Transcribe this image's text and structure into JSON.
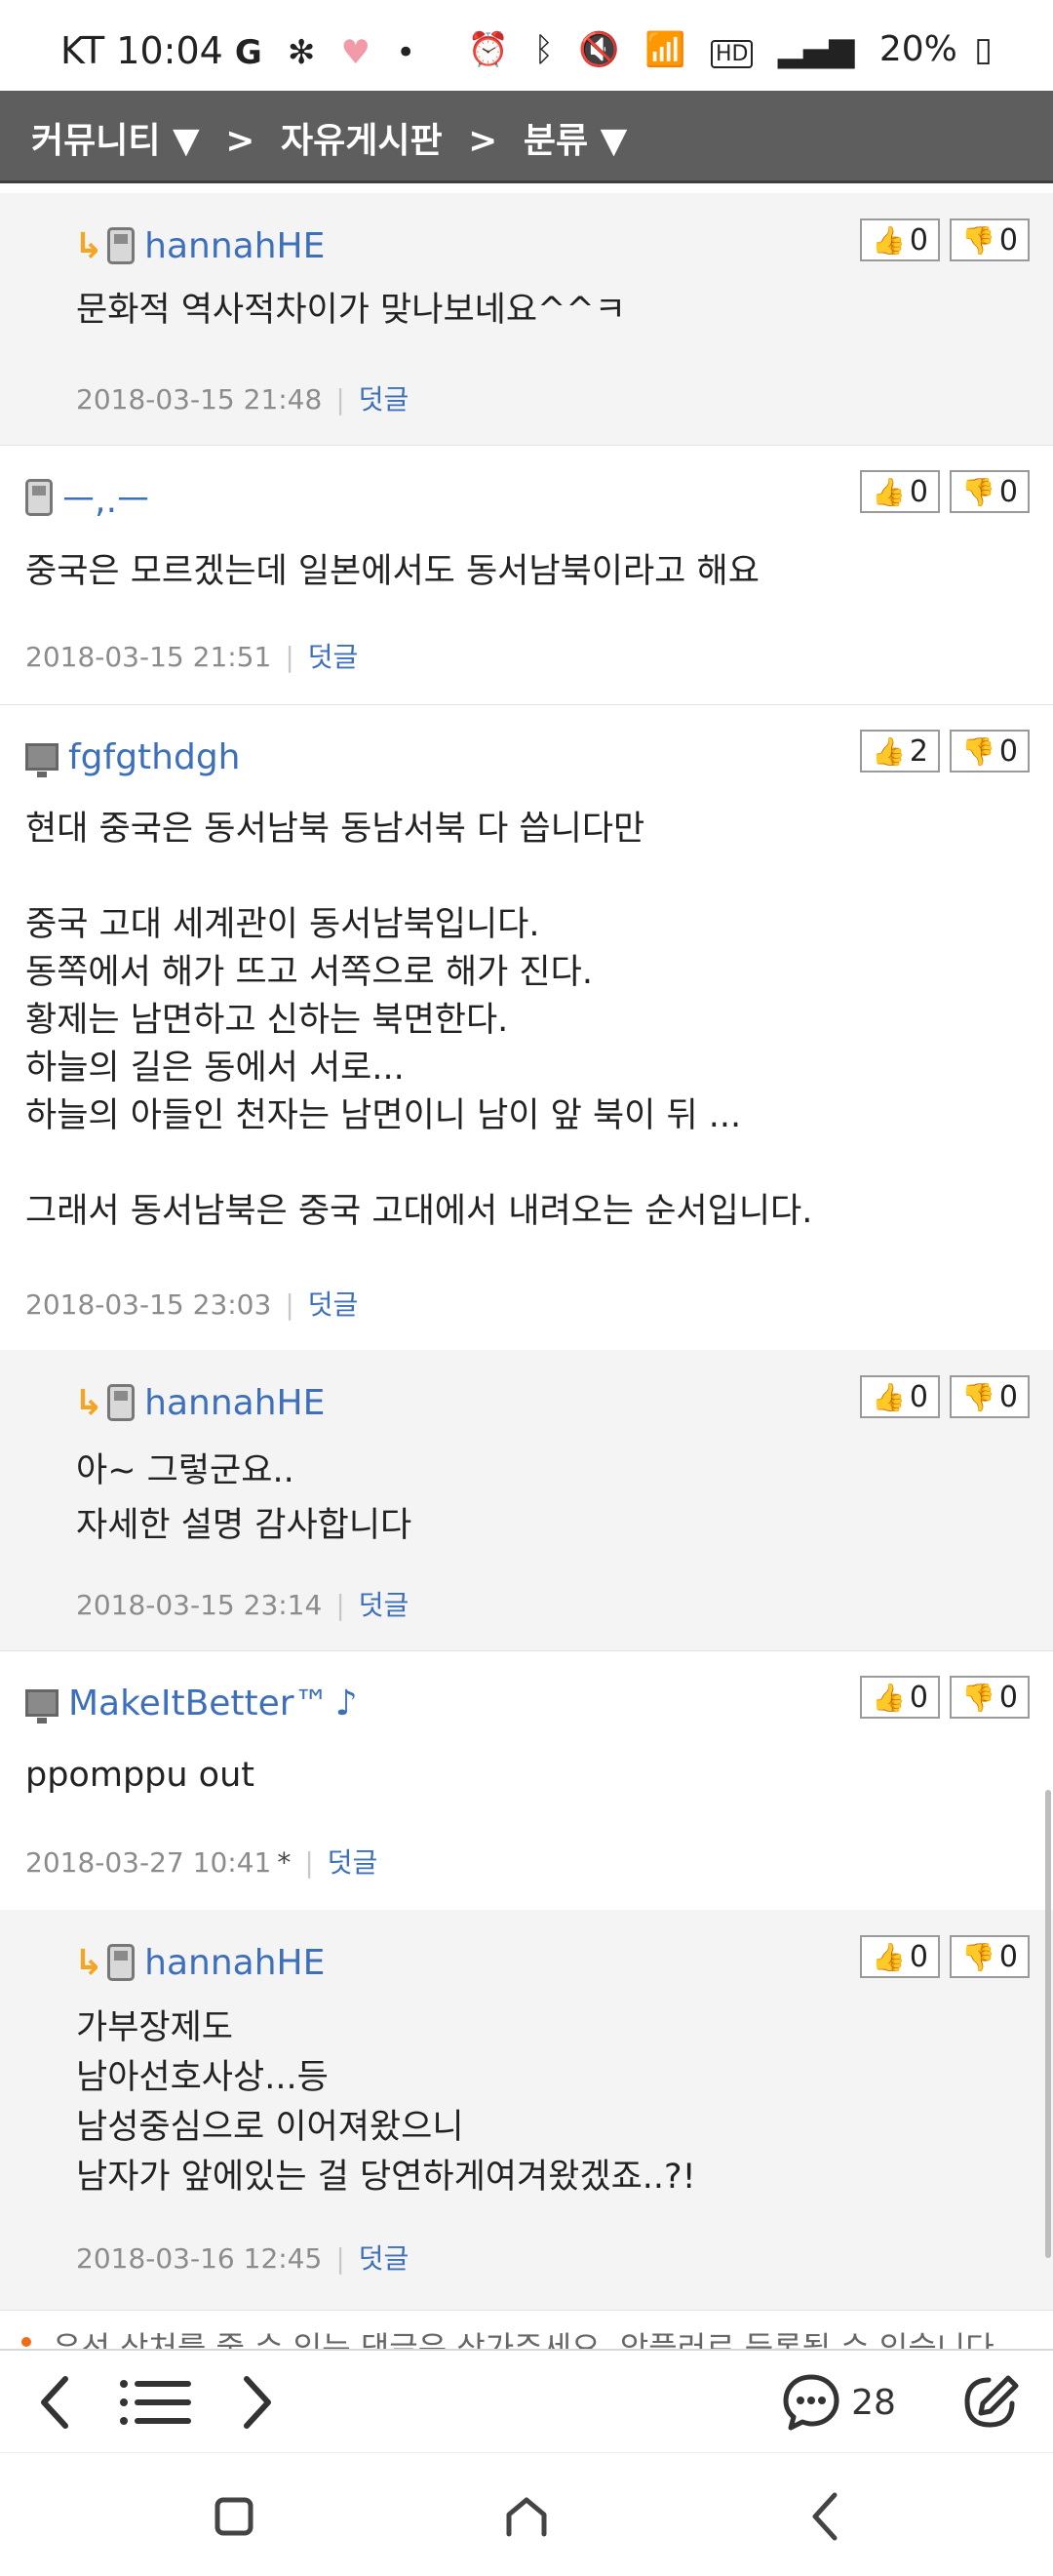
{
  "status_bar": {
    "carrier": "KT",
    "time": "10:04",
    "battery": "20%"
  },
  "nav": {
    "community": "커뮤니티 ▼",
    "sep1": ">",
    "board": "자유게시판",
    "sep2": ">",
    "category": "분류 ▼"
  },
  "comments": [
    {
      "author": "hannahHE",
      "text": "문화적 역사적차이가 맞나보네요^^ㅋ",
      "date": "2018-03-15 21:48",
      "reply_label": "덧글",
      "likes": "0",
      "dislikes": "0"
    },
    {
      "author": "ㅡ,.ㅡ",
      "text": "중국은 모르겠는데 일본에서도 동서남북이라고 해요",
      "date": "2018-03-15 21:51",
      "reply_label": "덧글",
      "likes": "0",
      "dislikes": "0"
    },
    {
      "author": "fgfgthdgh",
      "text": "현대 중국은 동서남북 동남서북 다 씁니다만\n\n중국 고대 세계관이 동서남북입니다.\n동쪽에서 해가 뜨고 서쪽으로 해가 진다.\n황제는 남면하고 신하는 북면한다.\n하늘의 길은 동에서 서로...\n하늘의 아들인 천자는 남면이니 남이 앞 북이 뒤 ...\n\n그래서 동서남북은 중국 고대에서 내려오는 순서입니다.",
      "date": "2018-03-15 23:03",
      "reply_label": "덧글",
      "likes": "2",
      "dislikes": "0"
    },
    {
      "author": "hannahHE",
      "text": "아~ 그렇군요..\n자세한 설명 감사합니다",
      "date": "2018-03-15 23:14",
      "reply_label": "덧글",
      "likes": "0",
      "dislikes": "0"
    },
    {
      "author": "MakeItBetter™",
      "author_note": "♪",
      "text": "ppomppu out",
      "date": "2018-03-27 10:41",
      "edited_mark": "*",
      "reply_label": "덧글",
      "likes": "0",
      "dislikes": "0"
    },
    {
      "author": "hannahHE",
      "text": "가부장제도\n남아선호사상...등\n남성중심으로 이어져왔으니\n남자가 앞에있는 걸 당연하게여겨왔겠죠..?!",
      "date": "2018-03-16 12:45",
      "reply_label": "덧글",
      "likes": "0",
      "dislikes": "0"
    }
  ],
  "hint_text": "유선 상처를 줄 수 있는 댓글은 삼가주세요. 앞플러로 등록될 수 있습니다.",
  "toolbar": {
    "comment_count": "28"
  },
  "accent_color": "#3d6fba",
  "header_color": "#5e5e5e"
}
